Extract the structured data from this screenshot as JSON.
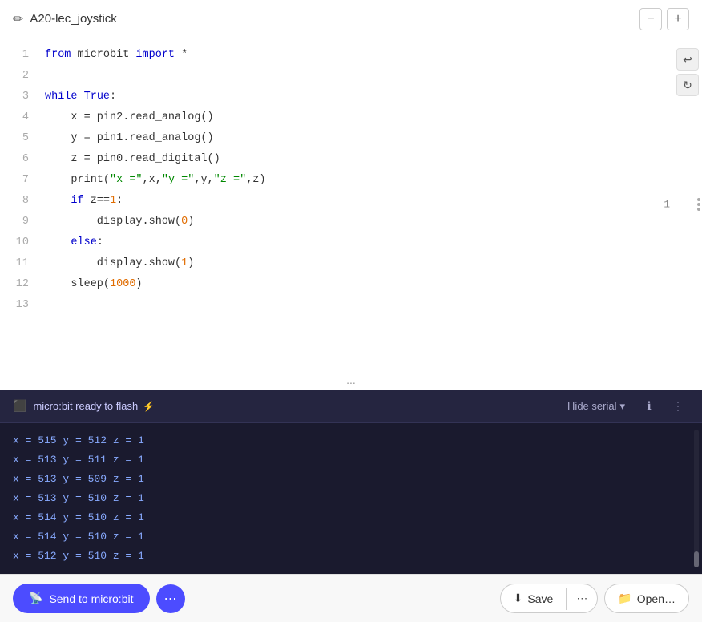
{
  "header": {
    "title": "A20-lec_joystick",
    "edit_icon": "✏",
    "zoom_out_label": "−",
    "zoom_in_label": "+"
  },
  "editor": {
    "undo_label": "↩",
    "redo_label": "↻",
    "cursor_position": "1",
    "lines": [
      {
        "num": 1,
        "code": "from microbit import *",
        "parts": [
          {
            "t": "kw",
            "v": "from"
          },
          {
            "t": "txt",
            "v": " microbit "
          },
          {
            "t": "kw",
            "v": "import"
          },
          {
            "t": "txt",
            "v": " *"
          }
        ]
      },
      {
        "num": 2,
        "code": "",
        "parts": []
      },
      {
        "num": 3,
        "code": "while True:",
        "parts": [
          {
            "t": "kw",
            "v": "while"
          },
          {
            "t": "txt",
            "v": " "
          },
          {
            "t": "kw-blue",
            "v": "True"
          },
          {
            "t": "txt",
            "v": ":"
          }
        ]
      },
      {
        "num": 4,
        "code": "    x = pin2.read_analog()",
        "parts": [
          {
            "t": "txt",
            "v": "    x = pin2.read_analog()"
          }
        ]
      },
      {
        "num": 5,
        "code": "    y = pin1.read_analog()",
        "parts": [
          {
            "t": "txt",
            "v": "    y = pin1.read_analog()"
          }
        ]
      },
      {
        "num": 6,
        "code": "    z = pin0.read_digital()",
        "parts": [
          {
            "t": "txt",
            "v": "    z = pin0.read_digital()"
          }
        ]
      },
      {
        "num": 7,
        "code": "    print(\"x =\",x,\"y =\",y,\"z =\",z)",
        "parts": [
          {
            "t": "txt",
            "v": "    print("
          },
          {
            "t": "str",
            "v": "\"x =\""
          },
          {
            "t": "txt",
            "v": ",x,"
          },
          {
            "t": "str",
            "v": "\"y =\""
          },
          {
            "t": "txt",
            "v": ",y,"
          },
          {
            "t": "str",
            "v": "\"z =\""
          },
          {
            "t": "txt",
            "v": ",z)"
          }
        ]
      },
      {
        "num": 8,
        "code": "    if z==1:",
        "parts": [
          {
            "t": "txt",
            "v": "    "
          },
          {
            "t": "kw",
            "v": "if"
          },
          {
            "t": "txt",
            "v": " z=="
          },
          {
            "t": "num",
            "v": "1"
          },
          {
            "t": "txt",
            "v": ":"
          }
        ]
      },
      {
        "num": 9,
        "code": "        display.show(0)",
        "parts": [
          {
            "t": "txt",
            "v": "        display.show("
          },
          {
            "t": "num",
            "v": "0"
          },
          {
            "t": "txt",
            "v": ")"
          }
        ]
      },
      {
        "num": 10,
        "code": "    else:",
        "parts": [
          {
            "t": "txt",
            "v": "    "
          },
          {
            "t": "kw",
            "v": "else"
          },
          {
            "t": "txt",
            "v": ":"
          }
        ]
      },
      {
        "num": 11,
        "code": "        display.show(1)",
        "parts": [
          {
            "t": "txt",
            "v": "        display.show("
          },
          {
            "t": "num",
            "v": "1"
          },
          {
            "t": "txt",
            "v": ")"
          }
        ]
      },
      {
        "num": 12,
        "code": "    sleep(1000)",
        "parts": [
          {
            "t": "txt",
            "v": "    sleep("
          },
          {
            "t": "num",
            "v": "1000"
          },
          {
            "t": "txt",
            "v": ")"
          }
        ]
      },
      {
        "num": 13,
        "code": "",
        "parts": []
      }
    ]
  },
  "serial": {
    "status_text": "micro:bit ready to flash",
    "flash_icon": "⚡",
    "hide_serial_label": "Hide serial",
    "chevron_down": "▾",
    "info_icon": "ℹ",
    "more_icon": "⋮",
    "output_lines": [
      "x = 515  y = 512  z = 1",
      "x = 513  y = 511  z = 1",
      "x = 513  y = 509  z = 1",
      "x = 513  y = 510  z = 1",
      "x = 514  y = 510  z = 1",
      "x = 514  y = 510  z = 1",
      "x = 512  y = 510  z = 1"
    ]
  },
  "toolbar": {
    "send_icon": "📡",
    "send_label": "Send to micro:bit",
    "send_more_icon": "⋯",
    "save_icon": "⬇",
    "save_label": "Save",
    "save_more_icon": "⋯",
    "open_icon": "📁",
    "open_label": "Open…",
    "ellipsis_text": "..."
  }
}
